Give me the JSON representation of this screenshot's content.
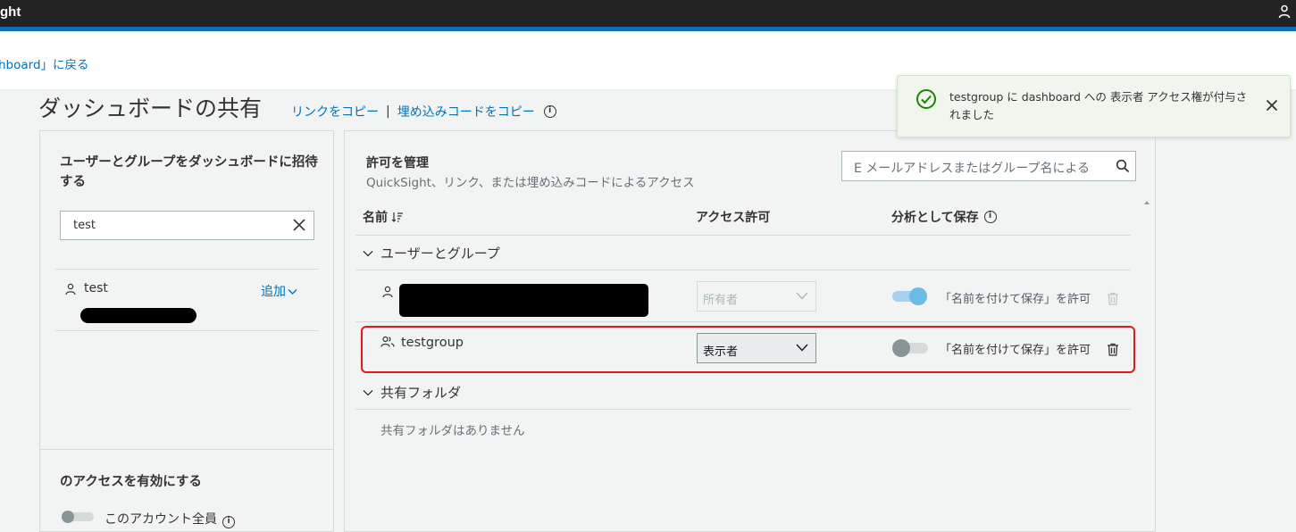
{
  "topbar": {
    "brand": "ght"
  },
  "subheader": {
    "back_link": "hboard」に戻る"
  },
  "page": {
    "title": "ダッシュボードの共有",
    "copy_link": "リンクをコピー",
    "separator": "|",
    "copy_embed": "埋め込みコードをコピー",
    "info_glyph": "i"
  },
  "invite": {
    "heading": "ユーザーとグループをダッシュボードに招待する",
    "search_value": "test",
    "result": {
      "name": "test",
      "add_label": "追加"
    },
    "access_heading": "のアクセスを有効にする",
    "all_accounts_label": "このアカウント全員",
    "info_glyph": "i"
  },
  "permissions": {
    "title": "許可を管理",
    "subtitle": "QuickSight、リンク、または埋め込みコードによるアクセス",
    "search_placeholder": "E メールアドレスまたはグループ名による",
    "columns": {
      "name": "名前",
      "access": "アクセス許可",
      "save_as_analysis": "分析として保存",
      "info_glyph": "i"
    },
    "sections": {
      "users_groups": "ユーザーとグループ",
      "shared_folders": "共有フォルダ"
    },
    "rows": [
      {
        "name": "",
        "access": "所有者",
        "save_enabled": true,
        "save_label": "「名前を付けて保存」を許可",
        "disabled": true
      },
      {
        "name": "testgroup",
        "access": "表示者",
        "save_enabled": false,
        "save_label": "「名前を付けて保存」を許可",
        "disabled": false
      }
    ],
    "no_shared_folders": "共有フォルダはありません"
  },
  "toast": {
    "message": "testgroup に dashboard への 表示者 アクセス権が付与されました",
    "status_color": "#1d8102"
  }
}
